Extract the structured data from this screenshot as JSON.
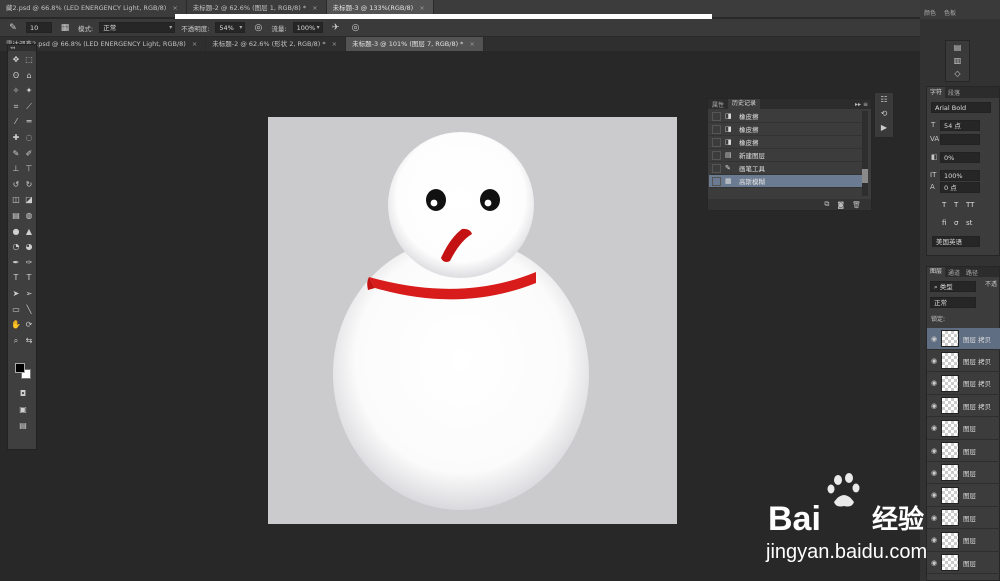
{
  "doc_tabs_top": [
    {
      "label": "藏2.psd @ 66.8% (LED ENERGENCY Light, RGB/8)",
      "active": false
    },
    {
      "label": "未标题-2 @ 62.6% (图层 1, RGB/8) *",
      "active": false
    },
    {
      "label": "未标题-3 @ 133%(RGB/8)",
      "active": true
    }
  ],
  "options_bar": {
    "brush_size": "10",
    "mode_label": "模式:",
    "mode_value": "正常",
    "opacity_label": "不透明度:",
    "opacity_value": "54%",
    "flow_label": "流量:",
    "flow_value": "100%"
  },
  "doc_tabs": [
    {
      "label": "雷达调鑫2.psd @ 66.8% (LED ENERGENCY Light, RGB/8)",
      "active": false
    },
    {
      "label": "未标题-2 @ 62.6% (形状 2, RGB/8) *",
      "active": false
    },
    {
      "label": "未标题-3 @ 101% (图层 7, RGB/8) *",
      "active": true
    }
  ],
  "history_panel": {
    "tabs": [
      "属性",
      "历史记录"
    ],
    "items": [
      {
        "icon": "eraser-icon",
        "label": "橡皮擦",
        "selected": false
      },
      {
        "icon": "eraser-icon",
        "label": "橡皮擦",
        "selected": false
      },
      {
        "icon": "eraser-icon",
        "label": "橡皮擦",
        "selected": false
      },
      {
        "icon": "new-layer-icon",
        "label": "新建图层",
        "selected": false
      },
      {
        "icon": "brush-icon",
        "label": "画笔工具",
        "selected": false
      },
      {
        "icon": "filter-icon",
        "label": "高斯模糊",
        "selected": true
      }
    ]
  },
  "character_panel": {
    "tabs": [
      "字符",
      "段落"
    ],
    "font": "Arial Bold",
    "size": "54 点",
    "tracking": "0%",
    "scale": "100%",
    "baseline": "0 点",
    "language": "美国英语"
  },
  "layers_panel": {
    "tabs": [
      "图层",
      "通道",
      "路径"
    ],
    "filter": "类型",
    "blend": "正常",
    "opacity_label": "不透",
    "lock_label": "锁定:",
    "layers": [
      {
        "name": "图层 拷贝",
        "selected": true
      },
      {
        "name": "图层 拷贝",
        "selected": false
      },
      {
        "name": "图层 拷贝",
        "selected": false
      },
      {
        "name": "图层 拷贝",
        "selected": false
      },
      {
        "name": "图层",
        "selected": false
      },
      {
        "name": "图层",
        "selected": false
      },
      {
        "name": "图层",
        "selected": false
      },
      {
        "name": "图层",
        "selected": false
      },
      {
        "name": "图层",
        "selected": false
      },
      {
        "name": "图层",
        "selected": false
      },
      {
        "name": "图层",
        "selected": false
      }
    ]
  },
  "side_tabs": [
    "颜色",
    "色板"
  ],
  "watermark": {
    "brand": "Bai",
    "brand_tail": "经验",
    "url": "jingyan.baidu.com"
  },
  "colors": {
    "canvas_bg": "#cbcacd",
    "scarf": "#d81b1b",
    "nose": "#c41212",
    "selection": "#6b7c92"
  }
}
